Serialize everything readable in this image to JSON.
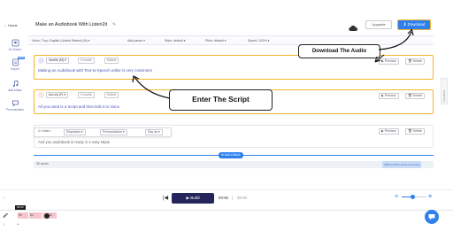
{
  "app": {
    "home_label": "← Home",
    "title": "Make an Audiobook With Listen2it"
  },
  "header": {
    "upgrade_label": "Upgrade",
    "download_label": "⬇ Download"
  },
  "toolbar": {
    "voice": "Voice: Troy, English (United States) (M) ▾",
    "add_pause": "Add pause ▾",
    "style": "Style: default ▾",
    "pitch": "Pitch: default ▾",
    "speed": "Speed: 100% ▾"
  },
  "sidebar": {
    "items": [
      {
        "label": "AI Voices"
      },
      {
        "label": "Import",
        "badge": "NEW"
      },
      {
        "label": "Add Music"
      },
      {
        "label": "Pronunciation"
      }
    ]
  },
  "blocks": [
    {
      "speaker": "Neville (M) ▾",
      "duration": "0 words",
      "status": "Edited",
      "text": "Making an Audiobook with Text-to-Speech editor is very convinient",
      "preview_label": "▶ Preview",
      "delete_label": "🗑 Delete"
    },
    {
      "speaker": "Aurora (F) ▾",
      "duration": "0 words",
      "status": "Edited",
      "text": "All you need is a Script and then Edit it to Voice",
      "preview_label": "▶ Preview",
      "delete_label": "🗑 Delete"
    },
    {
      "text": "And you audiobook is ready in 4 easy steps",
      "preview_label": "▶ Preview",
      "delete_label": "🗑 Delete"
    }
  ],
  "edit_bar": {
    "listen": "⊙ Listen",
    "emphasis": "Emphasis ▾",
    "pronunciation": "Pronunciation ▾",
    "say_as": "Say as ▾"
  },
  "add_block_label": "⊕ Add a Block",
  "word_count": "36 words",
  "chars_remaining": "4865 of 5000 words remaining",
  "feedback_label": "Feedback",
  "player": {
    "build_label": "▶ Build",
    "current_time": "00:00",
    "total_time": "00:00",
    "timeline_marker": "00:00",
    "tracks": [
      "Ne",
      "Au",
      "Ai"
    ]
  },
  "callouts": {
    "download": "Download The Audio",
    "script": "Enter The Script"
  },
  "colors": {
    "accent": "#2f80ed",
    "highlight": "#f5b52c",
    "purple": "#6a4fd8",
    "build": "#24255a"
  }
}
